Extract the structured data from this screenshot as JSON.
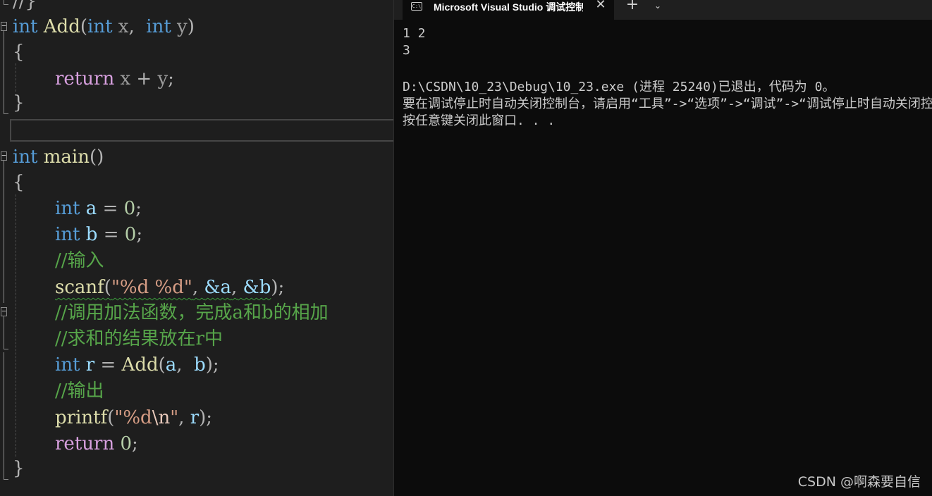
{
  "editor": {
    "top_fragment": "//}",
    "add_func": {
      "type1": "int",
      "name": "Add",
      "lparen": "(",
      "type2": "int",
      "p1": "x",
      "comma": ",",
      "type3": "int",
      "p2": "y",
      "rparen": ")",
      "open": "{",
      "ret": "return",
      "x": "x",
      "plus": "+",
      "y": "y",
      "semi": ";",
      "close": "}"
    },
    "main_func": {
      "type": "int",
      "name": "main",
      "parens": "()",
      "open": "{",
      "l1": {
        "kw": "int",
        "var": "a",
        "eq": "=",
        "num": "0",
        "semi": ";"
      },
      "l2": {
        "kw": "int",
        "var": "b",
        "eq": "=",
        "num": "0",
        "semi": ";"
      },
      "c1": "//输入",
      "l3": {
        "fn": "scanf",
        "lp": "(",
        "fmt": "\"%d %d\"",
        "comma1": ",",
        "arg1": "&a",
        "comma2": ",",
        "arg2": "&b",
        "rp": ")",
        "semi": ";"
      },
      "c2": "//调用加法函数，完成a和b的相加",
      "c3": "//求和的结果放在r中",
      "l4": {
        "kw": "int",
        "var": "r",
        "eq": "=",
        "fn": "Add",
        "lp": "(",
        "a": "a",
        "comma": ",",
        "b": "b",
        "rp": ")",
        "semi": ";"
      },
      "c4": "//输出",
      "l5": {
        "fn": "printf",
        "lp": "(",
        "fmt_open": "\"%d",
        "esc": "\\n",
        "fmt_close": "\"",
        "comma": ",",
        "r": "r",
        "rp": ")",
        "semi": ";"
      },
      "l6": {
        "ret": "return",
        "num": "0",
        "semi": ";"
      },
      "close": "}"
    }
  },
  "terminal": {
    "tab_title": "Microsoft Visual Studio 调试控制台",
    "tab_icon_text": "C:\\",
    "close_glyph": "✕",
    "new_tab_glyph": "+",
    "dropdown_glyph": "⌄",
    "lines": [
      "1 2",
      "3",
      "",
      "D:\\CSDN\\10_23\\Debug\\10_23.exe (进程 25240)已退出，代码为 0。",
      "要在调试停止时自动关闭控制台，请启用“工具”->“选项”->“调试”->“调试停止时自动关闭控制台”。",
      "按任意键关闭此窗口. . ."
    ]
  },
  "watermark": "CSDN @啊森要自信",
  "colors": {
    "editor_bg": "#1e1e1e",
    "keyword": "#569cd6",
    "control_keyword": "#d8a0df",
    "function": "#dcdcaa",
    "variable": "#9cdcfe",
    "number": "#b5cea8",
    "string": "#d69d85",
    "comment": "#57a64a",
    "terminal_bg": "#0c0c0c"
  }
}
